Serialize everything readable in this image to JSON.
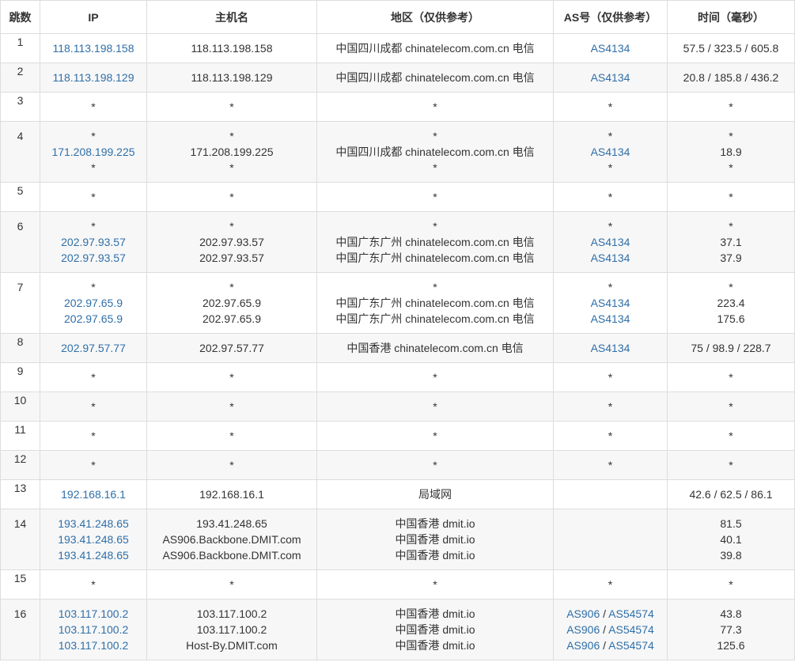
{
  "headers": [
    "跳数",
    "IP",
    "主机名",
    "地区（仅供参考）",
    "AS号（仅供参考）",
    "时间（毫秒）"
  ],
  "rows": [
    {
      "hop": "1",
      "ip": [
        "118.113.198.158"
      ],
      "host": [
        "118.113.198.158"
      ],
      "region": [
        "中国四川成都 chinatelecom.com.cn 电信"
      ],
      "as": [
        [
          "AS4134"
        ]
      ],
      "time": [
        "57.5 / 323.5 / 605.8"
      ]
    },
    {
      "hop": "2",
      "ip": [
        "118.113.198.129"
      ],
      "host": [
        "118.113.198.129"
      ],
      "region": [
        "中国四川成都 chinatelecom.com.cn 电信"
      ],
      "as": [
        [
          "AS4134"
        ]
      ],
      "time": [
        "20.8 / 185.8 / 436.2"
      ]
    },
    {
      "hop": "3",
      "ip": [
        "*"
      ],
      "host": [
        "*"
      ],
      "region": [
        "*"
      ],
      "as": [
        [
          "*"
        ]
      ],
      "time": [
        "*"
      ]
    },
    {
      "hop": "4",
      "ip": [
        "*",
        "171.208.199.225",
        "*"
      ],
      "host": [
        "*",
        "171.208.199.225",
        "*"
      ],
      "region": [
        "*",
        "中国四川成都 chinatelecom.com.cn 电信",
        "*"
      ],
      "as": [
        [
          "*"
        ],
        [
          "AS4134"
        ],
        [
          "*"
        ]
      ],
      "time": [
        "*",
        "18.9",
        "*"
      ]
    },
    {
      "hop": "5",
      "ip": [
        "*"
      ],
      "host": [
        "*"
      ],
      "region": [
        "*"
      ],
      "as": [
        [
          "*"
        ]
      ],
      "time": [
        "*"
      ]
    },
    {
      "hop": "6",
      "ip": [
        "*",
        "202.97.93.57",
        "202.97.93.57"
      ],
      "host": [
        "*",
        "202.97.93.57",
        "202.97.93.57"
      ],
      "region": [
        "*",
        "中国广东广州 chinatelecom.com.cn 电信",
        "中国广东广州 chinatelecom.com.cn 电信"
      ],
      "as": [
        [
          "*"
        ],
        [
          "AS4134"
        ],
        [
          "AS4134"
        ]
      ],
      "time": [
        "*",
        "37.1",
        "37.9"
      ]
    },
    {
      "hop": "7",
      "ip": [
        "*",
        "202.97.65.9",
        "202.97.65.9"
      ],
      "host": [
        "*",
        "202.97.65.9",
        "202.97.65.9"
      ],
      "region": [
        "*",
        "中国广东广州 chinatelecom.com.cn 电信",
        "中国广东广州 chinatelecom.com.cn 电信"
      ],
      "as": [
        [
          "*"
        ],
        [
          "AS4134"
        ],
        [
          "AS4134"
        ]
      ],
      "time": [
        "*",
        "223.4",
        "175.6"
      ]
    },
    {
      "hop": "8",
      "ip": [
        "202.97.57.77"
      ],
      "host": [
        "202.97.57.77"
      ],
      "region": [
        "中国香港 chinatelecom.com.cn 电信"
      ],
      "as": [
        [
          "AS4134"
        ]
      ],
      "time": [
        "75 / 98.9 / 228.7"
      ]
    },
    {
      "hop": "9",
      "ip": [
        "*"
      ],
      "host": [
        "*"
      ],
      "region": [
        "*"
      ],
      "as": [
        [
          "*"
        ]
      ],
      "time": [
        "*"
      ]
    },
    {
      "hop": "10",
      "ip": [
        "*"
      ],
      "host": [
        "*"
      ],
      "region": [
        "*"
      ],
      "as": [
        [
          "*"
        ]
      ],
      "time": [
        "*"
      ]
    },
    {
      "hop": "11",
      "ip": [
        "*"
      ],
      "host": [
        "*"
      ],
      "region": [
        "*"
      ],
      "as": [
        [
          "*"
        ]
      ],
      "time": [
        "*"
      ]
    },
    {
      "hop": "12",
      "ip": [
        "*"
      ],
      "host": [
        "*"
      ],
      "region": [
        "*"
      ],
      "as": [
        [
          "*"
        ]
      ],
      "time": [
        "*"
      ]
    },
    {
      "hop": "13",
      "ip": [
        "192.168.16.1"
      ],
      "host": [
        "192.168.16.1"
      ],
      "region": [
        "局域网"
      ],
      "as": [
        []
      ],
      "time": [
        "42.6 / 62.5 / 86.1"
      ]
    },
    {
      "hop": "14",
      "ip": [
        "193.41.248.65",
        "193.41.248.65",
        "193.41.248.65"
      ],
      "host": [
        "193.41.248.65",
        "AS906.Backbone.DMIT.com",
        "AS906.Backbone.DMIT.com"
      ],
      "region": [
        "中国香港 dmit.io",
        "中国香港 dmit.io",
        "中国香港 dmit.io"
      ],
      "as": [
        [],
        [],
        []
      ],
      "time": [
        "81.5",
        "40.1",
        "39.8"
      ]
    },
    {
      "hop": "15",
      "ip": [
        "*"
      ],
      "host": [
        "*"
      ],
      "region": [
        "*"
      ],
      "as": [
        [
          "*"
        ]
      ],
      "time": [
        "*"
      ]
    },
    {
      "hop": "16",
      "ip": [
        "103.117.100.2",
        "103.117.100.2",
        "103.117.100.2"
      ],
      "host": [
        "103.117.100.2",
        "103.117.100.2",
        "Host-By.DMIT.com"
      ],
      "region": [
        "中国香港 dmit.io",
        "中国香港 dmit.io",
        "中国香港 dmit.io"
      ],
      "as": [
        [
          "AS906",
          "AS54574"
        ],
        [
          "AS906",
          "AS54574"
        ],
        [
          "AS906",
          "AS54574"
        ]
      ],
      "time": [
        "43.8",
        "77.3",
        "125.6"
      ]
    }
  ],
  "colors": {
    "link": "#2f6fa8",
    "border": "#dddddd",
    "stripe": "#f7f7f7",
    "text": "#333333"
  }
}
